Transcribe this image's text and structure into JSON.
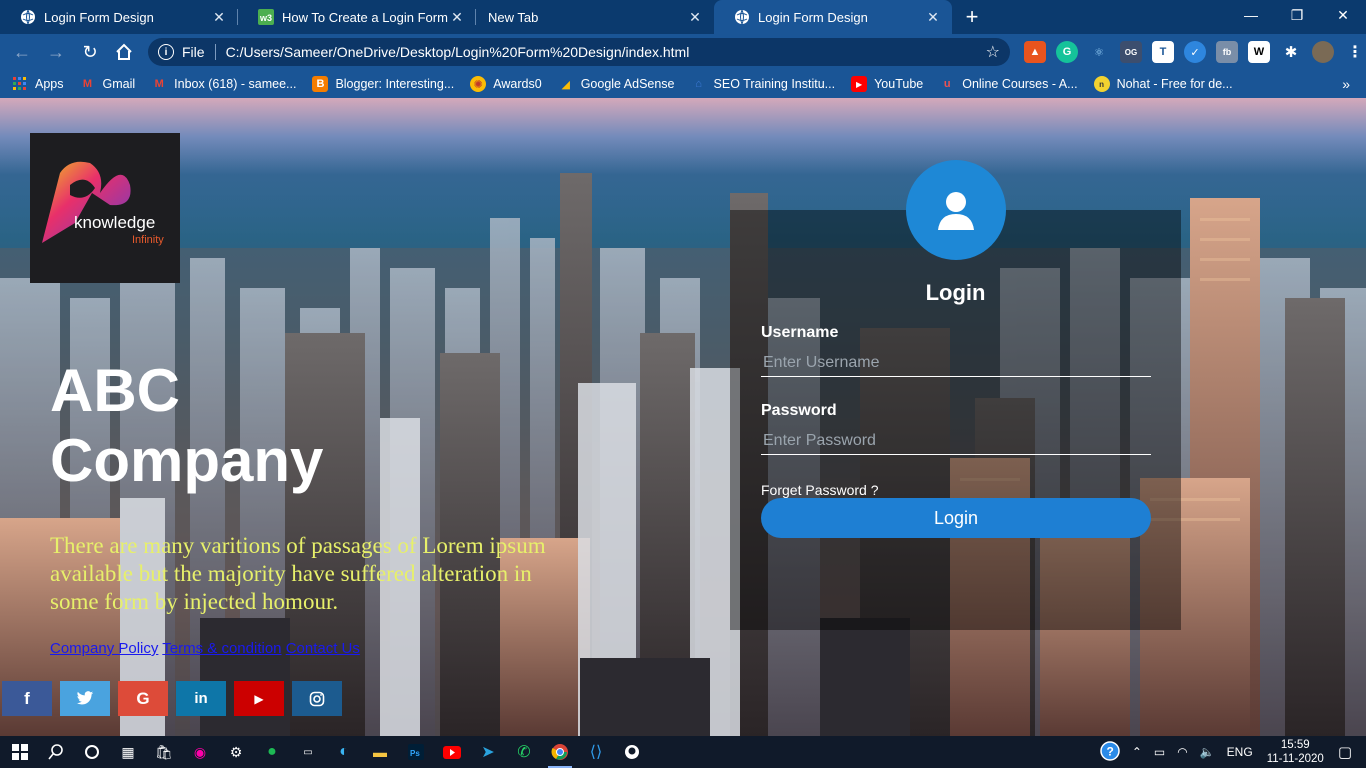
{
  "browser": {
    "tabs": [
      {
        "title": "Login Form Design",
        "active": false,
        "icon": "globe-icon"
      },
      {
        "title": "How To Create a Login Form",
        "active": false,
        "icon": "w3schools-icon"
      },
      {
        "title": "New Tab",
        "active": false,
        "icon": ""
      },
      {
        "title": "Login Form Design",
        "active": true,
        "icon": "globe-icon"
      }
    ],
    "address": {
      "scheme_label": "File",
      "url": "C:/Users/Sameer/OneDrive/Desktop/Login%20Form%20Design/index.html"
    },
    "bookmarks": [
      {
        "label": "Apps",
        "icon": "apps-grid-icon"
      },
      {
        "label": "Gmail",
        "icon": "gmail-icon"
      },
      {
        "label": "Inbox (618) - samee...",
        "icon": "gmail-icon"
      },
      {
        "label": "Blogger: Interesting...",
        "icon": "blogger-icon"
      },
      {
        "label": "Awards0",
        "icon": "award-icon"
      },
      {
        "label": "Google AdSense",
        "icon": "adsense-icon"
      },
      {
        "label": "SEO Training Institu...",
        "icon": "seo-icon"
      },
      {
        "label": "YouTube",
        "icon": "youtube-icon"
      },
      {
        "label": "Online Courses - A...",
        "icon": "udemy-icon"
      },
      {
        "label": "Nohat - Free for de...",
        "icon": "nohat-icon"
      }
    ]
  },
  "site": {
    "logo": {
      "word": "knowledge",
      "sub": "Infinity"
    },
    "company_line1": "ABC",
    "company_line2": "Company",
    "tagline": "There are many varitions of passages of Lorem ipsum available but the majority have suffered alteration in some form by injected homour.",
    "footer_links": [
      "Company Policy",
      "Terms & condition",
      "Contact Us"
    ],
    "social": [
      {
        "name": "facebook",
        "glyph": "f",
        "color": "#3b5998"
      },
      {
        "name": "twitter",
        "glyph": "🐦",
        "color": "#4aa3df"
      },
      {
        "name": "google",
        "glyph": "G",
        "color": "#dd4b39"
      },
      {
        "name": "linkedin",
        "glyph": "in",
        "color": "#0e76a8"
      },
      {
        "name": "youtube",
        "glyph": "▶",
        "color": "#cc0000"
      },
      {
        "name": "instagram",
        "glyph": "◎",
        "color": "#1c5b8f"
      }
    ],
    "login": {
      "title": "Login",
      "username_label": "Username",
      "username_placeholder": "Enter Username",
      "password_label": "Password",
      "password_placeholder": "Enter Password",
      "forgot": "Forget Password ?",
      "button": "Login",
      "accent": "#1e7fd3"
    }
  },
  "taskbar": {
    "language": "ENG",
    "time": "15:59",
    "date": "11-11-2020"
  }
}
